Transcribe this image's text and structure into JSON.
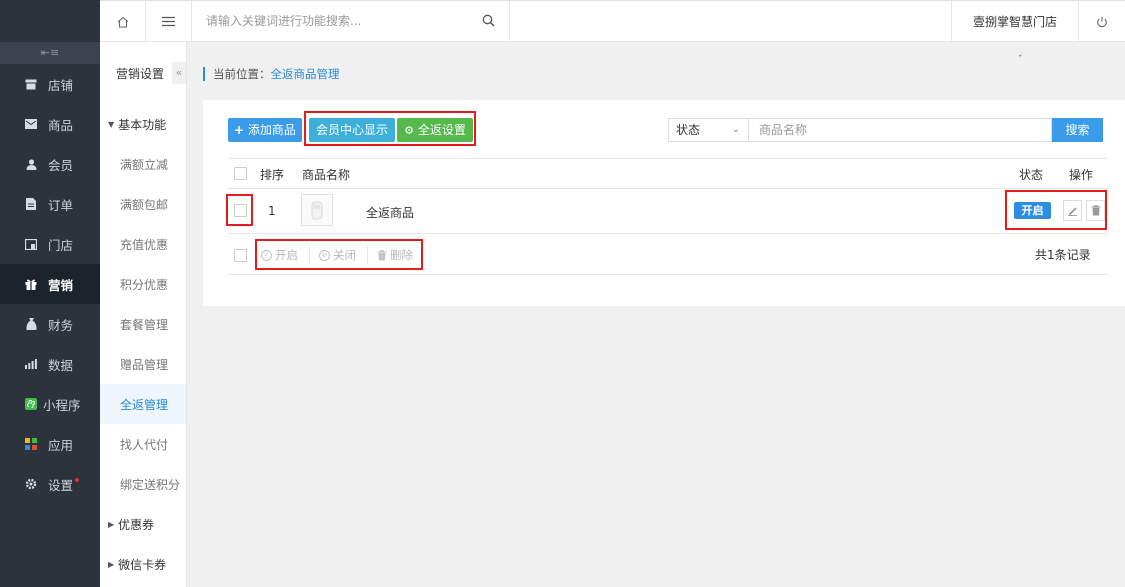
{
  "topbar": {
    "search_placeholder": "请输入关键词进行功能搜索...",
    "store_name": "壹捌掌智慧门店"
  },
  "sidebar": {
    "collapse_glyph": "⇤≡",
    "items": [
      {
        "label": "店铺",
        "icon": "shop-icon"
      },
      {
        "label": "商品",
        "icon": "product-icon"
      },
      {
        "label": "会员",
        "icon": "user-icon"
      },
      {
        "label": "订单",
        "icon": "order-icon"
      },
      {
        "label": "门店",
        "icon": "store-icon"
      },
      {
        "label": "营销",
        "icon": "gift-icon",
        "active": true
      },
      {
        "label": "财务",
        "icon": "money-icon"
      },
      {
        "label": "数据",
        "icon": "chart-icon"
      },
      {
        "label": "小程序",
        "icon": "miniprogram-icon"
      },
      {
        "label": "应用",
        "icon": "apps-icon"
      },
      {
        "label": "设置",
        "icon": "gear-icon"
      }
    ]
  },
  "subnav": {
    "title": "营销设置",
    "group_basic": "基本功能",
    "items": [
      "满额立减",
      "满额包邮",
      "充值优惠",
      "积分优惠",
      "套餐管理",
      "赠品管理",
      "全返管理",
      "找人代付",
      "绑定送积分"
    ],
    "active_item": "全返管理",
    "group_coupon": "优惠券",
    "group_wxcard": "微信卡券"
  },
  "breadcrumb": {
    "prefix": "当前位置：",
    "current": "全返商品管理"
  },
  "toolbar": {
    "add_label": "添加商品",
    "member_label": "会员中心显示",
    "all_return_label": "全返设置",
    "status_label": "状态",
    "name_placeholder": "商品名称",
    "search_label": "搜索"
  },
  "table": {
    "headers": {
      "sort": "排序",
      "name": "商品名称",
      "status": "状态",
      "ops": "操作"
    },
    "rows": [
      {
        "sort": "1",
        "name": "全返商品",
        "status": "开启"
      }
    ]
  },
  "batch": {
    "open": "开启",
    "close": "关闭",
    "delete": "删除",
    "total": "共1条记录"
  },
  "colors": {
    "accent": "#2a8ad4",
    "highlight_box": "#e41c1c",
    "green": "#55b94d",
    "sidebar_bg": "#2c333d"
  }
}
